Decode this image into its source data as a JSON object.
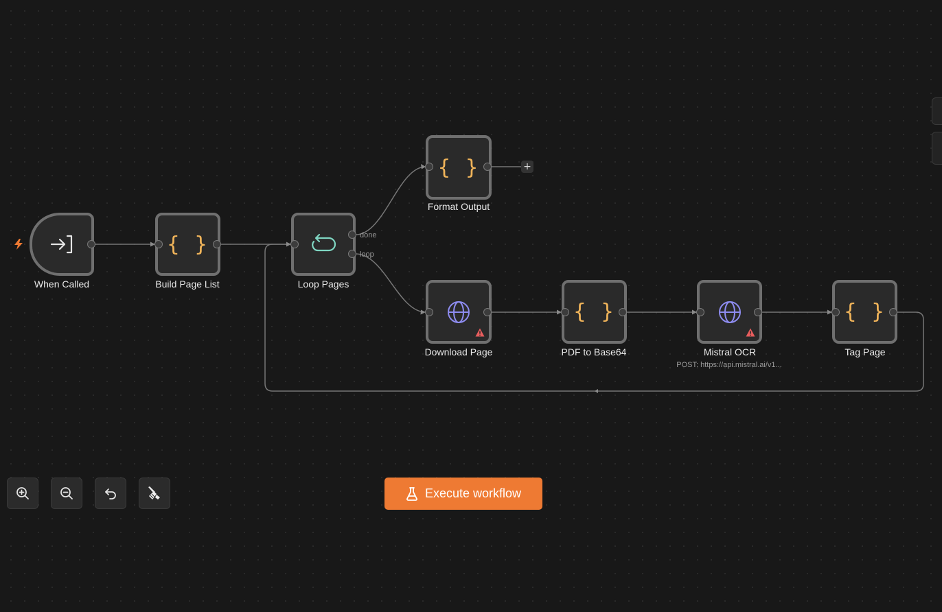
{
  "nodes": {
    "when_called": {
      "label": "When Called",
      "icon": "arrow-right-to-bracket-icon"
    },
    "build_page_list": {
      "label": "Build Page List",
      "icon": "code-braces-icon"
    },
    "loop_pages": {
      "label": "Loop Pages",
      "icon": "loop-icon",
      "outputs": {
        "done": "done",
        "loop": "loop"
      }
    },
    "format_output": {
      "label": "Format Output",
      "icon": "code-braces-icon"
    },
    "download_page": {
      "label": "Download Page",
      "icon": "globe-icon",
      "warning": true
    },
    "pdf_to_base64": {
      "label": "PDF to Base64",
      "icon": "code-braces-icon"
    },
    "mistral_ocr": {
      "label": "Mistral OCR",
      "icon": "globe-icon",
      "warning": true,
      "subtitle": "POST: https://api.mistral.ai/v1..."
    },
    "tag_page": {
      "label": "Tag Page",
      "icon": "code-braces-icon"
    }
  },
  "controls": {
    "zoom_in": "zoom-in-icon",
    "zoom_out": "zoom-out-icon",
    "reset": "undo-icon",
    "tidy": "broom-icon"
  },
  "execute": {
    "label": "Execute workflow",
    "icon": "flask-icon"
  },
  "add_label": "+",
  "colors": {
    "canvas": "#181818",
    "node_border": "#6f6f6f",
    "node_fill": "#2a2a2a",
    "accent": "#ee7a33",
    "braces": "#f0b45a",
    "globe": "#8e8cf0",
    "loop": "#7fd6c2",
    "warning": "#e85d5d"
  }
}
